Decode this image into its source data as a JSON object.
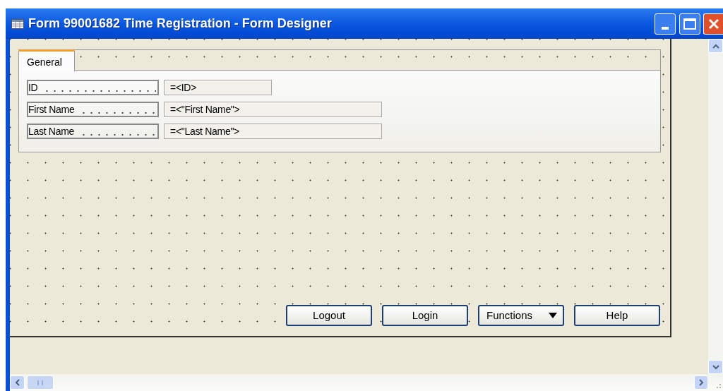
{
  "window": {
    "title": "Form 99001682 Time Registration - Form Designer"
  },
  "tabs": [
    {
      "label": "General",
      "selected": true
    }
  ],
  "fields": [
    {
      "label": "ID",
      "value": "=<ID>"
    },
    {
      "label": "First Name",
      "value": "=<\"First Name\">"
    },
    {
      "label": "Last Name",
      "value": "=<\"Last Name\">"
    }
  ],
  "buttons": [
    {
      "label": "Logout",
      "kind": "button"
    },
    {
      "label": "Login",
      "kind": "button"
    },
    {
      "label": "Functions",
      "kind": "menu"
    },
    {
      "label": "Help",
      "kind": "button"
    }
  ]
}
